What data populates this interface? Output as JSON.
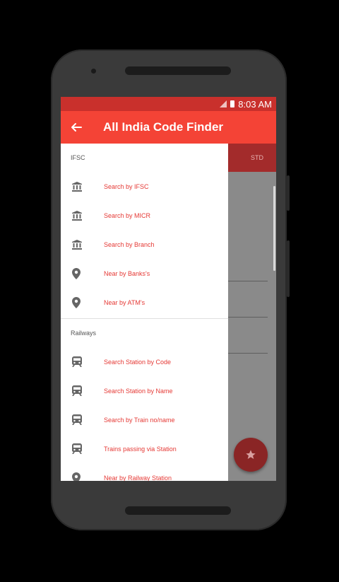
{
  "status_bar": {
    "time": "8:03 AM"
  },
  "app_bar": {
    "title": "All India Code Finder"
  },
  "background_tabs": {
    "visible_tab": "STD"
  },
  "drawer": {
    "sections": [
      {
        "header": "IFSC",
        "items": [
          {
            "label": "Search by IFSC",
            "icon": "bank-icon"
          },
          {
            "label": "Search by MICR",
            "icon": "bank-icon"
          },
          {
            "label": "Search by Branch",
            "icon": "bank-icon"
          },
          {
            "label": "Near by Banks's",
            "icon": "location-pin-icon"
          },
          {
            "label": "Near by ATM's",
            "icon": "location-pin-icon"
          }
        ]
      },
      {
        "header": "Railways",
        "items": [
          {
            "label": "Search Station by Code",
            "icon": "train-icon"
          },
          {
            "label": "Search Station by Name",
            "icon": "train-icon"
          },
          {
            "label": "Search by Train no/name",
            "icon": "train-icon"
          },
          {
            "label": "Trains passing via Station",
            "icon": "train-icon"
          },
          {
            "label": "Near by Railway Station",
            "icon": "location-pin-icon"
          }
        ]
      }
    ]
  },
  "colors": {
    "primary": "#f44336",
    "status_bar": "#c9302c",
    "accent_text": "#e53935",
    "fab": "#8a2525"
  }
}
